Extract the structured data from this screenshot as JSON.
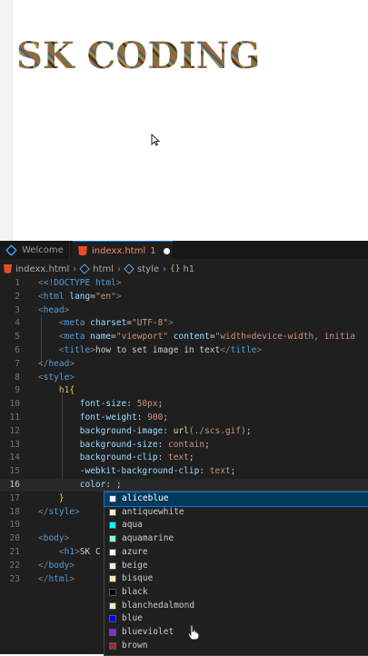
{
  "preview": {
    "heading": "SK CODING"
  },
  "tabs": [
    {
      "label": "Welcome",
      "icon": "vscode-icon"
    },
    {
      "label": "indexx.html",
      "badge": "1",
      "icon": "html5-icon",
      "modified": true
    }
  ],
  "breadcrumb": {
    "file": "indexx.html",
    "node1": "html",
    "node2": "style",
    "node3": "h1"
  },
  "code": {
    "l1": {
      "n": "1",
      "a": "<!DOCTYPE ",
      "b": "html",
      "c": ">"
    },
    "l2": {
      "n": "2",
      "a": "html",
      "b": "lang",
      "c": "\"en\""
    },
    "l3": {
      "n": "3",
      "a": "head"
    },
    "l4": {
      "n": "4",
      "a": "meta",
      "b": "charset",
      "c": "\"UTF-8\""
    },
    "l5": {
      "n": "5",
      "a": "meta",
      "b": "name",
      "c": "\"viewport\"",
      "d": "content",
      "e": "\"width=device-width, initia"
    },
    "l6": {
      "n": "6",
      "a": "title",
      "b": "how to set image in text",
      "c": "title"
    },
    "l7": {
      "n": "7",
      "a": "head"
    },
    "l8": {
      "n": "8",
      "a": "style"
    },
    "l9": {
      "n": "9",
      "a": "h1",
      "b": "{"
    },
    "l10": {
      "n": "10",
      "a": "font-size",
      "b": "50px"
    },
    "l11": {
      "n": "11",
      "a": "font-weight",
      "b": "900"
    },
    "l12": {
      "n": "12",
      "a": "background-image",
      "b": "url",
      "c": "(./scs.gif)"
    },
    "l13": {
      "n": "13",
      "a": "background-size",
      "b": "contain"
    },
    "l14": {
      "n": "14",
      "a": "background-clip",
      "b": "text"
    },
    "l15": {
      "n": "15",
      "a": "-webkit-background-clip",
      "b": "text"
    },
    "l16": {
      "n": "16",
      "a": "color"
    },
    "l17": {
      "n": "17",
      "a": "}"
    },
    "l18": {
      "n": "18",
      "a": "style"
    },
    "l19": {
      "n": "19"
    },
    "l20": {
      "n": "20",
      "a": "body"
    },
    "l21": {
      "n": "21",
      "a": "h1",
      "b": "SK C"
    },
    "l22": {
      "n": "22",
      "a": "body"
    },
    "l23": {
      "n": "23",
      "a": "html"
    }
  },
  "suggestions": [
    {
      "label": "aliceblue",
      "color": "#f0f8ff",
      "selected": true
    },
    {
      "label": "antiquewhite",
      "color": "#faebd7"
    },
    {
      "label": "aqua",
      "color": "#00ffff"
    },
    {
      "label": "aquamarine",
      "color": "#7fffd4"
    },
    {
      "label": "azure",
      "color": "#f0ffff"
    },
    {
      "label": "beige",
      "color": "#f5f5dc"
    },
    {
      "label": "bisque",
      "color": "#ffe4c4"
    },
    {
      "label": "black",
      "color": "#000000"
    },
    {
      "label": "blanchedalmond",
      "color": "#ffebcd"
    },
    {
      "label": "blue",
      "color": "#0000ff"
    },
    {
      "label": "blueviolet",
      "color": "#8a2be2"
    },
    {
      "label": "brown",
      "color": "#a52a2a"
    }
  ]
}
